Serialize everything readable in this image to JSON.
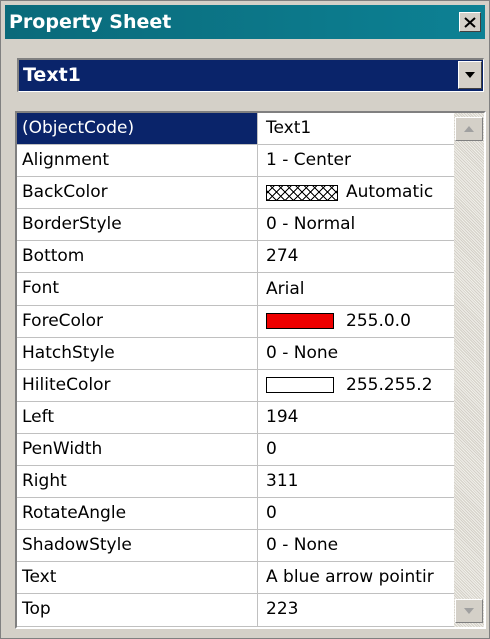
{
  "window": {
    "title": "Property Sheet",
    "close_icon": "close-icon"
  },
  "object_selector": {
    "value": "Text1",
    "arrow_icon": "chevron-down-icon"
  },
  "properties": [
    {
      "name": "(ObjectCode)",
      "value": "Text1",
      "selected": true
    },
    {
      "name": "Alignment",
      "value": "1 - Center"
    },
    {
      "name": "BackColor",
      "value": "Automatic",
      "swatch": "pattern"
    },
    {
      "name": "BorderStyle",
      "value": "0 - Normal"
    },
    {
      "name": "Bottom",
      "value": "274"
    },
    {
      "name": "Font",
      "value": "Arial"
    },
    {
      "name": "ForeColor",
      "value": "255.0.0",
      "swatch": "#ee0000"
    },
    {
      "name": "HatchStyle",
      "value": "0 - None"
    },
    {
      "name": "HiliteColor",
      "value": "255.255.2",
      "swatch": "#ffffff"
    },
    {
      "name": "Left",
      "value": "194"
    },
    {
      "name": "PenWidth",
      "value": "0"
    },
    {
      "name": "Right",
      "value": "311"
    },
    {
      "name": "RotateAngle",
      "value": "0"
    },
    {
      "name": "ShadowStyle",
      "value": "0 - None"
    },
    {
      "name": "Text",
      "value": "A blue arrow pointir"
    },
    {
      "name": "Top",
      "value": "223"
    }
  ],
  "colors": {
    "titlebar": "#0d8194",
    "selection": "#0a246a",
    "window_bg": "#d4d0c8"
  }
}
